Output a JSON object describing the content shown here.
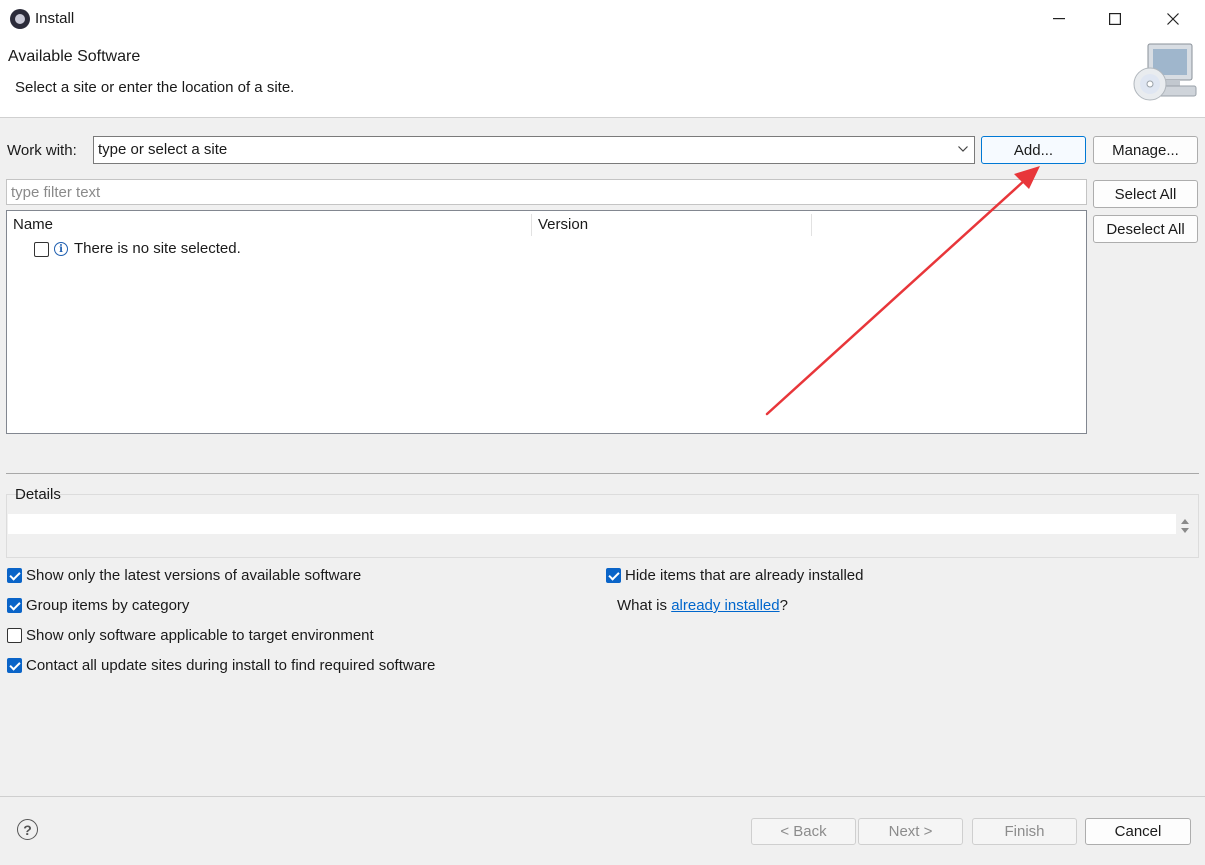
{
  "window": {
    "title": "Install"
  },
  "header": {
    "title": "Available Software",
    "subtitle": "Select a site or enter the location of a site."
  },
  "work_with": {
    "label": "Work with:",
    "value": "type or select a site",
    "add_label": "Add...",
    "manage_label": "Manage..."
  },
  "filter": {
    "placeholder": "type filter text"
  },
  "buttons": {
    "select_all": "Select All",
    "deselect_all": "Deselect All"
  },
  "table": {
    "columns": [
      "Name",
      "Version"
    ],
    "rows": [
      {
        "text": "There is no site selected.",
        "checked": false
      }
    ]
  },
  "details": {
    "label": "Details"
  },
  "options": {
    "left": [
      {
        "label": "Show only the latest versions of available software",
        "checked": true
      },
      {
        "label": "Group items by category",
        "checked": true
      },
      {
        "label": "Show only software applicable to target environment",
        "checked": false
      },
      {
        "label": "Contact all update sites during install to find required software",
        "checked": true
      }
    ],
    "hide_installed": {
      "label": "Hide items that are already installed",
      "checked": true
    },
    "what_is": {
      "prefix": "What is ",
      "link": "already installed",
      "suffix": "?"
    }
  },
  "footer": {
    "back": "< Back",
    "next": "Next >",
    "finish": "Finish",
    "cancel": "Cancel"
  },
  "colors": {
    "accent": "#0078d4",
    "checkbox": "#0a64c8",
    "link": "#0066cc",
    "arrow": "#e8363a"
  }
}
